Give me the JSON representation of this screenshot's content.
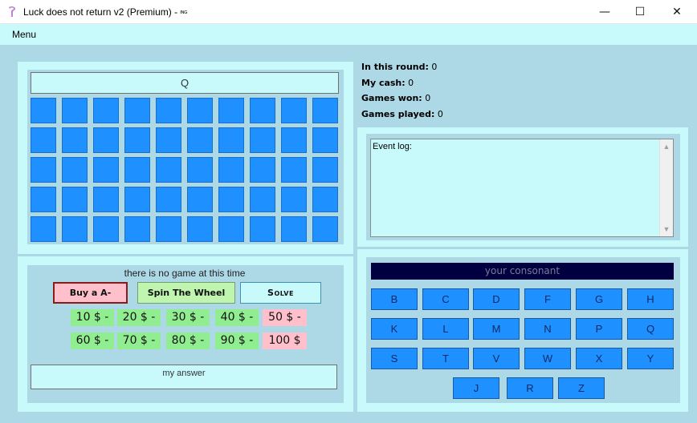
{
  "window": {
    "title": "Luck does not return v2 (Premium) -",
    "title_tag": "ᴵᴺᴳ",
    "minimize": "—",
    "maximize": "☐",
    "close": "✕"
  },
  "menu": {
    "label": "Menu"
  },
  "board": {
    "clue": "Q",
    "rows": 5,
    "cols": 10,
    "tile_color": "#1e90ff"
  },
  "controls": {
    "status": "there is no game at this time",
    "buy_vowel": "Buy a A-",
    "spin": "Spin The Wheel",
    "solve": "Solve",
    "prices": [
      {
        "label": "10 $ -",
        "style": "green"
      },
      {
        "label": "20 $ -",
        "style": "green"
      },
      {
        "label": "30 $ -",
        "style": "green"
      },
      {
        "label": "40 $ -",
        "style": "green"
      },
      {
        "label": "50 $ -",
        "style": "pink"
      },
      {
        "label": "60 $ -",
        "style": "green"
      },
      {
        "label": "70 $ -",
        "style": "green"
      },
      {
        "label": "80 $ -",
        "style": "green"
      },
      {
        "label": "90 $ -",
        "style": "green"
      },
      {
        "label": "100 $",
        "style": "pink"
      }
    ],
    "answer_placeholder": "my answer"
  },
  "stats": {
    "round_label": "In this round:",
    "round_value": "0",
    "cash_label": "My cash:",
    "cash_value": "0",
    "won_label": "Games won:",
    "won_value": "0",
    "played_label": "Games played:",
    "played_value": "0"
  },
  "log": {
    "label": "Event log:"
  },
  "consonants": {
    "title": "your consonant",
    "letters": [
      "B",
      "C",
      "D",
      "F",
      "G",
      "H",
      "K",
      "L",
      "M",
      "N",
      "P",
      "Q",
      "S",
      "T",
      "V",
      "W",
      "X",
      "Y",
      "J",
      "R",
      "Z"
    ]
  },
  "colors": {
    "panel_bg": "#c8fafc",
    "client_bg": "#add8e6",
    "tile": "#1e90ff",
    "price_green": "#90ee90",
    "price_pink": "#ffc0cb",
    "header_dark": "#000040"
  }
}
